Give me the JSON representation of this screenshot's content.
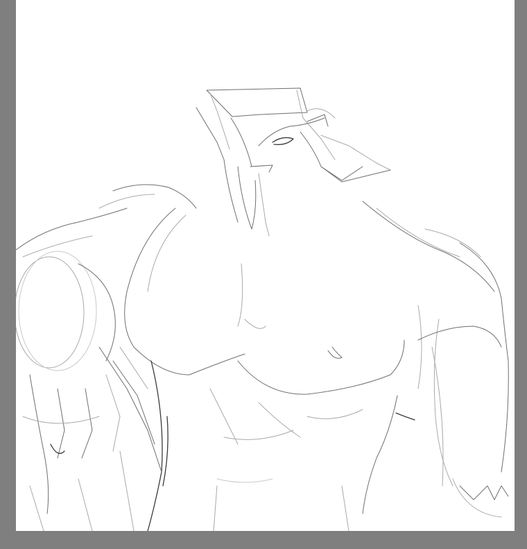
{
  "app": {
    "workspace_color": "#7f7f7f",
    "canvas_color": "#ffffff"
  },
  "canvas": {
    "content": "pencil-sketch"
  }
}
